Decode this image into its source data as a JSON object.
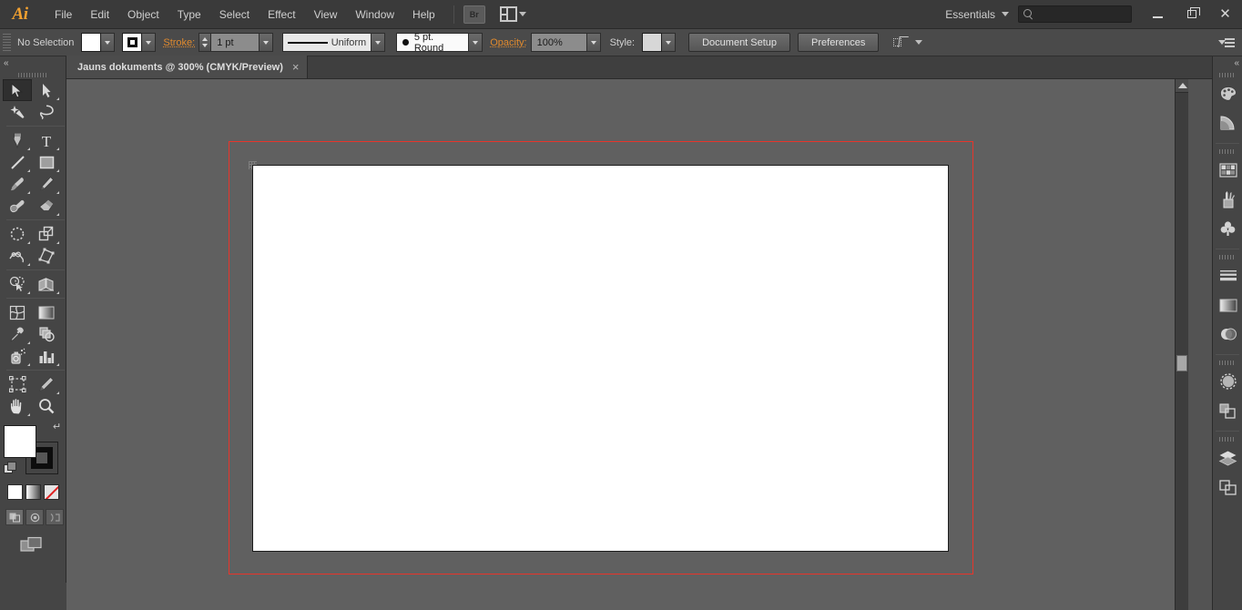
{
  "app": {
    "name": "Adobe Illustrator",
    "logo_text": "Ai"
  },
  "titlebar": {
    "menus": [
      {
        "label": "File"
      },
      {
        "label": "Edit"
      },
      {
        "label": "Object"
      },
      {
        "label": "Type"
      },
      {
        "label": "Select"
      },
      {
        "label": "Effect"
      },
      {
        "label": "View"
      },
      {
        "label": "Window"
      },
      {
        "label": "Help"
      }
    ],
    "bridge_button_label": "Br",
    "arrange_documents_icon": "arrange-documents-icon",
    "workspace_label": "Essentials",
    "search_value": "",
    "search_placeholder": "",
    "window_controls": {
      "minimize": "minimize-button",
      "restore": "restore-button",
      "close": "close-button"
    }
  },
  "optionsbar": {
    "selection_status": "No Selection",
    "fill_swatch_color": "#ffffff",
    "stroke_swatch_color": "#000000",
    "stroke_label": "Stroke:",
    "stroke_weight": "1 pt",
    "stroke_profile": "Uniform",
    "brush_definition": "5 pt. Round",
    "opacity_label": "Opacity:",
    "opacity_value": "100%",
    "style_label": "Style:",
    "style_swatch_color": "#d7d7d7",
    "document_setup_label": "Document Setup",
    "preferences_label": "Preferences",
    "align_icon": "align-to-pixel-grid-icon",
    "panel_menu_icon": "panel-menu-icon"
  },
  "document_tab": {
    "title": "Jauns dokuments @ 300% (CMYK/Preview)",
    "close_label": "×"
  },
  "tools": {
    "collapse_label": "«",
    "items": [
      {
        "name": "selection-tool",
        "active": true,
        "flyout": false
      },
      {
        "name": "direct-selection-tool",
        "active": false,
        "flyout": true
      },
      {
        "name": "magic-wand-tool",
        "active": false,
        "flyout": false
      },
      {
        "name": "lasso-tool",
        "active": false,
        "flyout": false
      },
      {
        "name": "pen-tool",
        "active": false,
        "flyout": true
      },
      {
        "name": "type-tool",
        "active": false,
        "flyout": true
      },
      {
        "name": "line-segment-tool",
        "active": false,
        "flyout": true
      },
      {
        "name": "rectangle-tool",
        "active": false,
        "flyout": true
      },
      {
        "name": "paintbrush-tool",
        "active": false,
        "flyout": true
      },
      {
        "name": "pencil-tool",
        "active": false,
        "flyout": true
      },
      {
        "name": "blob-brush-tool",
        "active": false,
        "flyout": false
      },
      {
        "name": "eraser-tool",
        "active": false,
        "flyout": true
      },
      {
        "name": "rotate-tool",
        "active": false,
        "flyout": true
      },
      {
        "name": "scale-tool",
        "active": false,
        "flyout": true
      },
      {
        "name": "width-tool",
        "active": false,
        "flyout": true
      },
      {
        "name": "free-transform-tool",
        "active": false,
        "flyout": false
      },
      {
        "name": "shape-builder-tool",
        "active": false,
        "flyout": true
      },
      {
        "name": "perspective-grid-tool",
        "active": false,
        "flyout": true
      },
      {
        "name": "mesh-tool",
        "active": false,
        "flyout": false
      },
      {
        "name": "gradient-tool",
        "active": false,
        "flyout": false
      },
      {
        "name": "eyedropper-tool",
        "active": false,
        "flyout": true
      },
      {
        "name": "blend-tool",
        "active": false,
        "flyout": false
      },
      {
        "name": "symbol-sprayer-tool",
        "active": false,
        "flyout": true
      },
      {
        "name": "column-graph-tool",
        "active": false,
        "flyout": true
      },
      {
        "name": "artboard-tool",
        "active": false,
        "flyout": false
      },
      {
        "name": "slice-tool",
        "active": false,
        "flyout": true
      },
      {
        "name": "hand-tool",
        "active": false,
        "flyout": true
      },
      {
        "name": "zoom-tool",
        "active": false,
        "flyout": false
      }
    ],
    "fill_color": "#ffffff",
    "stroke_color": "#000000",
    "swap_icon": "swap-fill-stroke-icon",
    "default_icon": "default-fill-stroke-icon",
    "color_mode_buttons": [
      "color-button",
      "gradient-button",
      "none-button"
    ],
    "drawing_modes": [
      "draw-normal-button",
      "draw-behind-button",
      "draw-inside-button"
    ],
    "screen_mode_icon": "change-screen-mode-icon"
  },
  "canvas": {
    "artboard_fill": "#ffffff",
    "bleed_color": "#e8352b",
    "background": "#606060",
    "scrollbar": {
      "up_arrow": "scroll-up-arrow",
      "down_arrow": "scroll-down-arrow",
      "thumb": "scroll-thumb"
    }
  },
  "rightdock": {
    "collapse_label": "«",
    "groups": [
      {
        "panels": [
          {
            "name": "color-panel-icon"
          },
          {
            "name": "color-guide-panel-icon"
          }
        ]
      },
      {
        "panels": [
          {
            "name": "swatches-panel-icon"
          },
          {
            "name": "brushes-panel-icon"
          },
          {
            "name": "symbols-panel-icon"
          }
        ]
      },
      {
        "panels": [
          {
            "name": "stroke-panel-icon"
          },
          {
            "name": "gradient-panel-icon"
          },
          {
            "name": "transparency-panel-icon"
          }
        ]
      },
      {
        "panels": [
          {
            "name": "appearance-panel-icon"
          },
          {
            "name": "graphic-styles-panel-icon"
          }
        ]
      },
      {
        "panels": [
          {
            "name": "layers-panel-icon"
          },
          {
            "name": "artboards-panel-icon"
          }
        ]
      }
    ]
  }
}
